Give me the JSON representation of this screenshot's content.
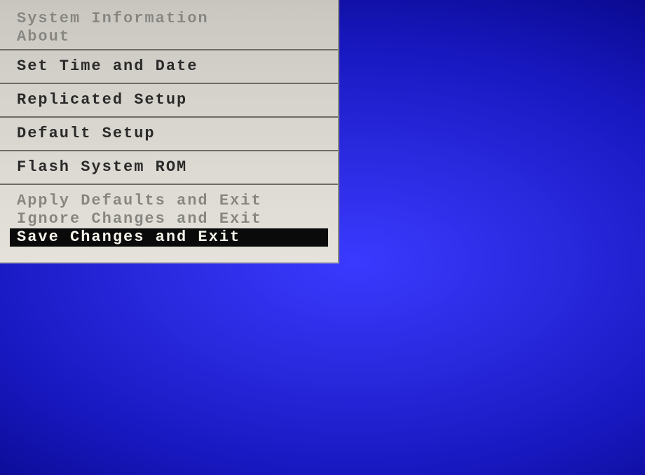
{
  "menu": {
    "groups": [
      {
        "items": [
          {
            "label": "System Information",
            "dim": true,
            "selected": false
          },
          {
            "label": "About",
            "dim": true,
            "selected": false
          }
        ]
      },
      {
        "items": [
          {
            "label": "Set Time and Date",
            "dim": false,
            "selected": false
          }
        ]
      },
      {
        "items": [
          {
            "label": "Replicated Setup",
            "dim": false,
            "selected": false
          }
        ]
      },
      {
        "items": [
          {
            "label": "Default Setup",
            "dim": false,
            "selected": false
          }
        ]
      },
      {
        "items": [
          {
            "label": "Flash System ROM",
            "dim": false,
            "selected": false
          }
        ]
      },
      {
        "items": [
          {
            "label": "Apply Defaults and Exit",
            "dim": true,
            "selected": false
          },
          {
            "label": "Ignore Changes and Exit",
            "dim": true,
            "selected": false
          },
          {
            "label": "Save Changes and Exit",
            "dim": false,
            "selected": true
          }
        ]
      }
    ]
  }
}
